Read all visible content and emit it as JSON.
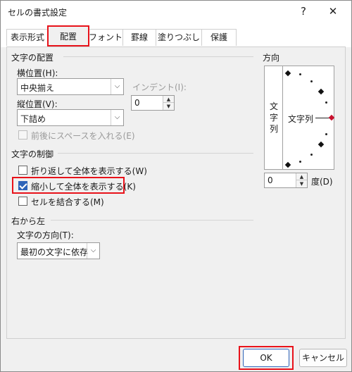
{
  "window": {
    "title": "セルの書式設定",
    "help_icon": "?",
    "close_icon": "✕"
  },
  "tabs": [
    {
      "label": "表示形式"
    },
    {
      "label": "配置"
    },
    {
      "label": "フォント"
    },
    {
      "label": "罫線"
    },
    {
      "label": "塗りつぶし"
    },
    {
      "label": "保護"
    }
  ],
  "alignment": {
    "group_title": "文字の配置",
    "horizontal_label": "横位置(H):",
    "horizontal_value": "中央揃え",
    "indent_label": "インデント(I):",
    "indent_value": "0",
    "vertical_label": "縦位置(V):",
    "vertical_value": "下詰め",
    "justify_distributed_label": "前後にスペースを入れる(E)"
  },
  "text_control": {
    "group_title": "文字の制御",
    "wrap_text_label": "折り返して全体を表示する(W)",
    "shrink_to_fit_label": "縮小して全体を表示する(K)",
    "merge_cells_label": "セルを結合する(M)",
    "wrap_text_checked": false,
    "shrink_to_fit_checked": true,
    "merge_cells_checked": false
  },
  "rtl": {
    "group_title": "右から左",
    "direction_label": "文字の方向(T):",
    "direction_value": "最初の文字に依存"
  },
  "orientation": {
    "group_title": "方向",
    "vertical_text": [
      "文",
      "字",
      "列"
    ],
    "text_label": "文字列",
    "degrees_value": "0",
    "degrees_label": "度(D)"
  },
  "footer": {
    "ok_label": "OK",
    "cancel_label": "キャンセル"
  },
  "colors": {
    "highlight": "#e8121a",
    "check_accent": "#2e63b8"
  }
}
